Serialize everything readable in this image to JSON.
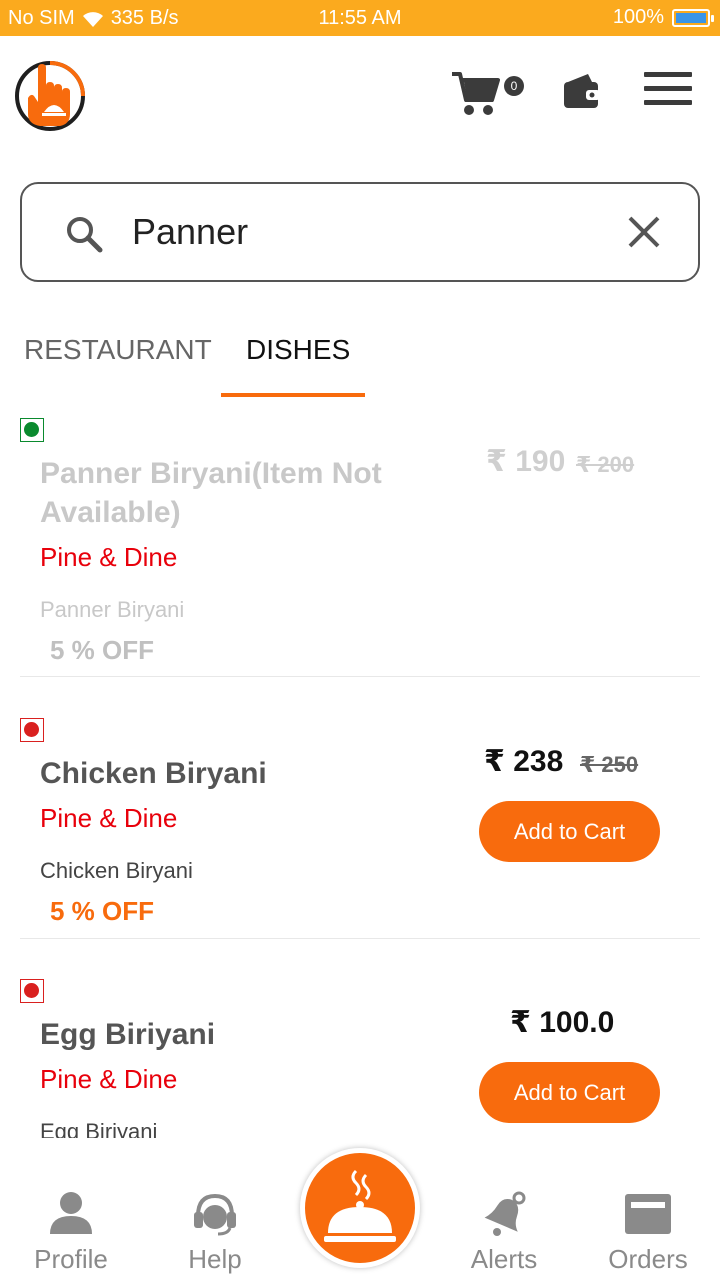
{
  "status_bar": {
    "carrier": "No SIM",
    "net_speed": "335 B/s",
    "time": "11:55 AM",
    "battery": "100%",
    "battery_level": 1.0
  },
  "header": {
    "cart_count": "0"
  },
  "search": {
    "query": "Panner"
  },
  "tabs": [
    {
      "label": "RESTAURANT"
    },
    {
      "label": "DISHES"
    }
  ],
  "active_tab": "DISHES",
  "dishes": [
    {
      "name": "Panner Biryani(Item Not Available)",
      "restaurant": "Pine & Dine",
      "description": "Panner Biryani",
      "discount": "5 % OFF",
      "price": "₹ 190",
      "old_price": "₹ 200",
      "veg": true,
      "available": false
    },
    {
      "name": "Chicken Biryani",
      "restaurant": "Pine & Dine",
      "description": "Chicken Biryani",
      "discount": "5 % OFF",
      "price": "₹ 238",
      "old_price": "₹ 250",
      "veg": false,
      "available": true,
      "button": "Add to Cart"
    },
    {
      "name": "Egg Biriyani",
      "restaurant": "Pine & Dine",
      "description": "Egg Biriyani",
      "price": "₹ 100.0",
      "veg": false,
      "available": true,
      "button": "Add to Cart"
    }
  ],
  "bottom_nav": [
    {
      "label": "Profile",
      "icon": "person-icon"
    },
    {
      "label": "Help",
      "icon": "headset-icon"
    },
    {
      "label": "Alerts",
      "icon": "bell-icon"
    },
    {
      "label": "Orders",
      "icon": "orders-icon"
    }
  ],
  "colors": {
    "status_bar": "#FBAA1E",
    "accent": "#F86B0D",
    "restaurant_text": "#E8000B",
    "veg": "#0A8A2E",
    "non_veg": "#D9201F"
  }
}
